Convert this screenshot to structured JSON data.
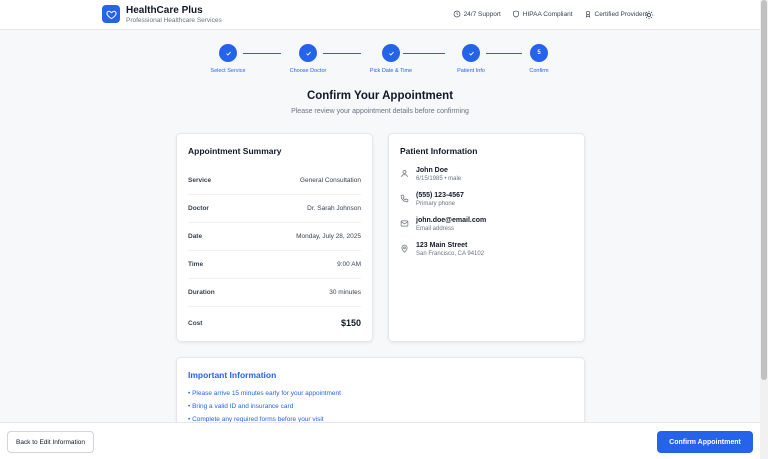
{
  "brand": {
    "title": "HealthCare Plus",
    "subtitle": "Professional Healthcare Services"
  },
  "header_links": [
    {
      "label": "24/7 Support",
      "icon": "clock-icon"
    },
    {
      "label": "HIPAA Compliant",
      "icon": "shield-icon"
    },
    {
      "label": "Certified Providers",
      "icon": "award-icon"
    }
  ],
  "steps": [
    {
      "label": "Select Service",
      "state": "done"
    },
    {
      "label": "Choose Doctor",
      "state": "done"
    },
    {
      "label": "Pick Date & Time",
      "state": "done"
    },
    {
      "label": "Patient Info",
      "state": "done"
    },
    {
      "label": "Confirm",
      "number": "5",
      "state": "current"
    }
  ],
  "page": {
    "title": "Confirm Your Appointment",
    "subtitle": "Please review your appointment details before confirming"
  },
  "summary": {
    "title": "Appointment Summary",
    "rows": [
      {
        "label": "Service",
        "value": "General Consultation"
      },
      {
        "label": "Doctor",
        "value": "Dr. Sarah Johnson"
      },
      {
        "label": "Date",
        "value": "Monday, July 28, 2025"
      },
      {
        "label": "Time",
        "value": "9:00 AM"
      },
      {
        "label": "Duration",
        "value": "30 minutes"
      },
      {
        "label": "Cost",
        "value": "$150"
      }
    ]
  },
  "patient": {
    "title": "Patient Information",
    "name": "John Doe",
    "details": "6/15/1985 • male",
    "phone": "(555) 123-4567",
    "phone_label": "Primary phone",
    "email": "john.doe@email.com",
    "email_label": "Email address",
    "street": "123 Main Street",
    "city": "San Francisco, CA 94102"
  },
  "important": {
    "title": "Important Information",
    "items": [
      "• Please arrive 15 minutes early for your appointment",
      "• Bring a valid ID and insurance card",
      "• Complete any required forms before your visit"
    ]
  },
  "footer": {
    "back_label": "Back to Edit Information",
    "confirm_label": "Confirm Appointment"
  },
  "colors": {
    "accent": "#2563eb",
    "text": "#111827",
    "muted": "#6b7280"
  }
}
